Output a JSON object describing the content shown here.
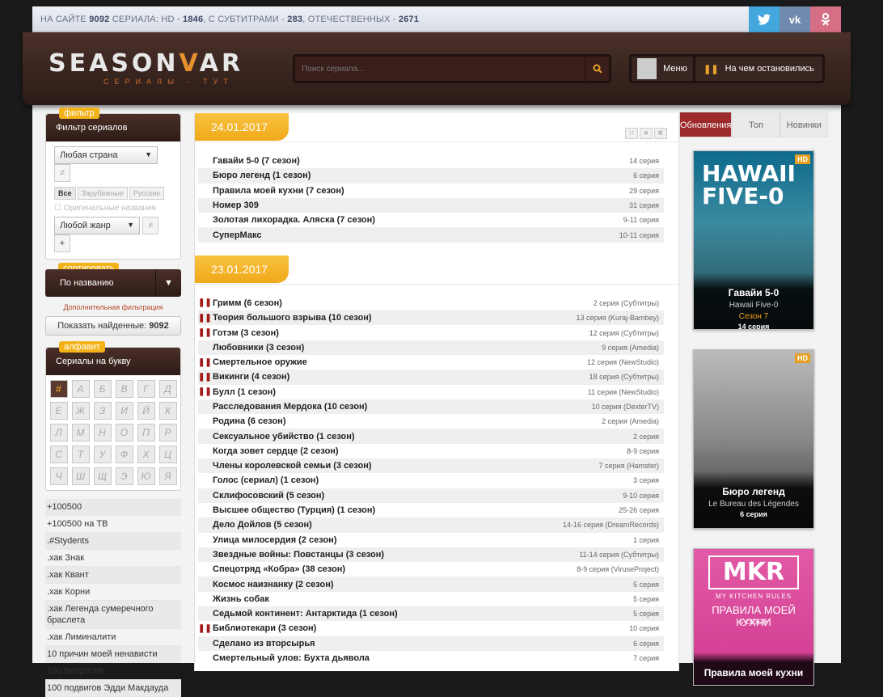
{
  "topbar": {
    "prefix": "НА САЙТЕ",
    "total": "9092",
    "word": "СЕРИАЛА: HD -",
    "hd": "1846",
    "subs_label": ", С СУБТИТРАМИ -",
    "subs": "283",
    "dom_label": ", ОТЕЧЕСТВЕННЫХ -",
    "dom": "2671"
  },
  "social": {
    "tw": "t",
    "vk": "vk",
    "ok": "ok"
  },
  "logo": {
    "name_a": "SEASON",
    "name_v": "V",
    "name_b": "AR",
    "sub": "СЕРИАЛЫ - ТУТ"
  },
  "search": {
    "placeholder": "Поиск сериала..."
  },
  "menu": {
    "menu_label": "Меню",
    "last_label": "На чем остановились"
  },
  "filter": {
    "tag": "фильтр",
    "title": "Фильтр сериалов",
    "country": "Любая страна",
    "tabs": [
      "Все",
      "Зарубежные",
      "Русские"
    ],
    "orig": "Оригинальные названия",
    "genre": "Любой жанр",
    "not_sym": "≠",
    "plus": "+"
  },
  "sort": {
    "tag": "сортировать",
    "value": "По названию",
    "arrow": "▼"
  },
  "adv_link": "Дополнительная фильтрация",
  "show": {
    "label": "Показать найденные:",
    "count": "9092"
  },
  "alphabet": {
    "tag": "алфавит",
    "title": "Сериалы на букву",
    "letters": [
      "#",
      "А",
      "Б",
      "В",
      "Г",
      "Д",
      "Е",
      "Ж",
      "З",
      "И",
      "Й",
      "К",
      "Л",
      "М",
      "Н",
      "О",
      "П",
      "Р",
      "С",
      "Т",
      "У",
      "Ф",
      "Х",
      "Ц",
      "Ч",
      "Ш",
      "Щ",
      "Э",
      "Ю",
      "Я"
    ]
  },
  "series_list": [
    "+100500",
    "+100500 на ТВ",
    ".#Stydents",
    ".хак Знак",
    ".хак Квант",
    ".хак Корни",
    ".хак Легенда сумеречного браслета",
    ".хак Лиминалити",
    "10 причин моей ненависти",
    "100 Вопросов",
    "100 подвигов Эдди Макдауда"
  ],
  "days": [
    {
      "date": "24.01.2017",
      "episodes": [
        {
          "title": "Гавайи 5-0 (7 сезон)",
          "info": "14 серия",
          "paused": false
        },
        {
          "title": "Бюро легенд (1 сезон)",
          "info": "6 серия",
          "paused": false
        },
        {
          "title": "Правила моей кухни (7 сезон)",
          "info": "29 серия",
          "paused": false
        },
        {
          "title": "Номер 309",
          "info": "31 серия",
          "paused": false
        },
        {
          "title": "Золотая лихорадка. Аляска (7 сезон)",
          "info": "9-11 серия",
          "paused": false
        },
        {
          "title": "СуперМакс",
          "info": "10-11 серия",
          "paused": false
        }
      ]
    },
    {
      "date": "23.01.2017",
      "episodes": [
        {
          "title": "Гримм (6 сезон)",
          "info": "2 серия (Субтитры)",
          "paused": true
        },
        {
          "title": "Теория большого взрыва (10 сезон)",
          "info": "13 серия (Kuraj-Bambey)",
          "paused": true
        },
        {
          "title": "Готэм (3 сезон)",
          "info": "12 серия (Субтитры)",
          "paused": true
        },
        {
          "title": "Любовники (3 сезон)",
          "info": "9 серия (Amedia)",
          "paused": false
        },
        {
          "title": "Смертельное оружие",
          "info": "12 серия (NewStudio)",
          "paused": true
        },
        {
          "title": "Викинги (4 сезон)",
          "info": "18 серия (Субтитры)",
          "paused": true
        },
        {
          "title": "Булл (1 сезон)",
          "info": "11 серия (NewStudio)",
          "paused": true
        },
        {
          "title": "Расследования Мердока (10 сезон)",
          "info": "10 серия (DexterTV)",
          "paused": false
        },
        {
          "title": "Родина (6 сезон)",
          "info": "2 серия (Amedia)",
          "paused": false
        },
        {
          "title": "Сексуальное убийство (1 сезон)",
          "info": "2 серия",
          "paused": false
        },
        {
          "title": "Когда зовет сердце (2 сезон)",
          "info": "8-9 серия",
          "paused": false
        },
        {
          "title": "Члены королевской семьи (3 сезон)",
          "info": "7 серия (Hamster)",
          "paused": false
        },
        {
          "title": "Голос (сериал) (1 сезон)",
          "info": "3 серия",
          "paused": false
        },
        {
          "title": "Склифосовский (5 сезон)",
          "info": "9-10 серия",
          "paused": false
        },
        {
          "title": "Высшее общество (Турция) (1 сезон)",
          "info": "25-26 серия",
          "paused": false
        },
        {
          "title": "Дело Дойлов (5 сезон)",
          "info": "14-16 серия (DreamRecords)",
          "paused": false
        },
        {
          "title": "Улица милосердия (2 сезон)",
          "info": "1 серия",
          "paused": false
        },
        {
          "title": "Звездные войны: Повстанцы (3 сезон)",
          "info": "11-14 серия (Субтитры)",
          "paused": false
        },
        {
          "title": "Спецотряд «Кобра» (38 сезон)",
          "info": "8-9 серия (ViruseProject)",
          "paused": false
        },
        {
          "title": "Космос наизнанку (2 сезон)",
          "info": "5 серия",
          "paused": false
        },
        {
          "title": "Жизнь собак",
          "info": "5 серия",
          "paused": false
        },
        {
          "title": "Седьмой континент: Антарктида (1 сезон)",
          "info": "5 серия",
          "paused": false
        },
        {
          "title": "Библиотекари (3 сезон)",
          "info": "10 серия",
          "paused": true
        },
        {
          "title": "Сделано из вторсырья",
          "info": "6 серия",
          "paused": false
        },
        {
          "title": "Смертельный улов: Бухта дьявола",
          "info": "7 серия",
          "paused": false
        }
      ]
    }
  ],
  "right_tabs": [
    "Обновления",
    "Топ",
    "Новинки"
  ],
  "cards": [
    {
      "hd": "HD",
      "poster_text": "HAWAII FIVE-0",
      "title": "Гавайи 5-0",
      "orig": "Hawaii Five-0",
      "season": "Сезон 7",
      "ep": "14 серия"
    },
    {
      "hd": "HD",
      "title": "Бюро легенд",
      "orig": "Le Bureau des Légendes",
      "ep": "6 серия"
    },
    {
      "poster_logo": "MKR",
      "poster_sub1": "MY KITCHEN RULES",
      "poster_sub2": "ПРАВИЛА МОЕЙ КУХНИ",
      "poster_sub3": "5 СЕЗОН",
      "title": "Правила моей кухни"
    }
  ],
  "colors": {
    "accent": "#f3b21a",
    "brown": "#3a2620",
    "pause": "#a21a1a",
    "tab_active": "#9c2a2a"
  }
}
